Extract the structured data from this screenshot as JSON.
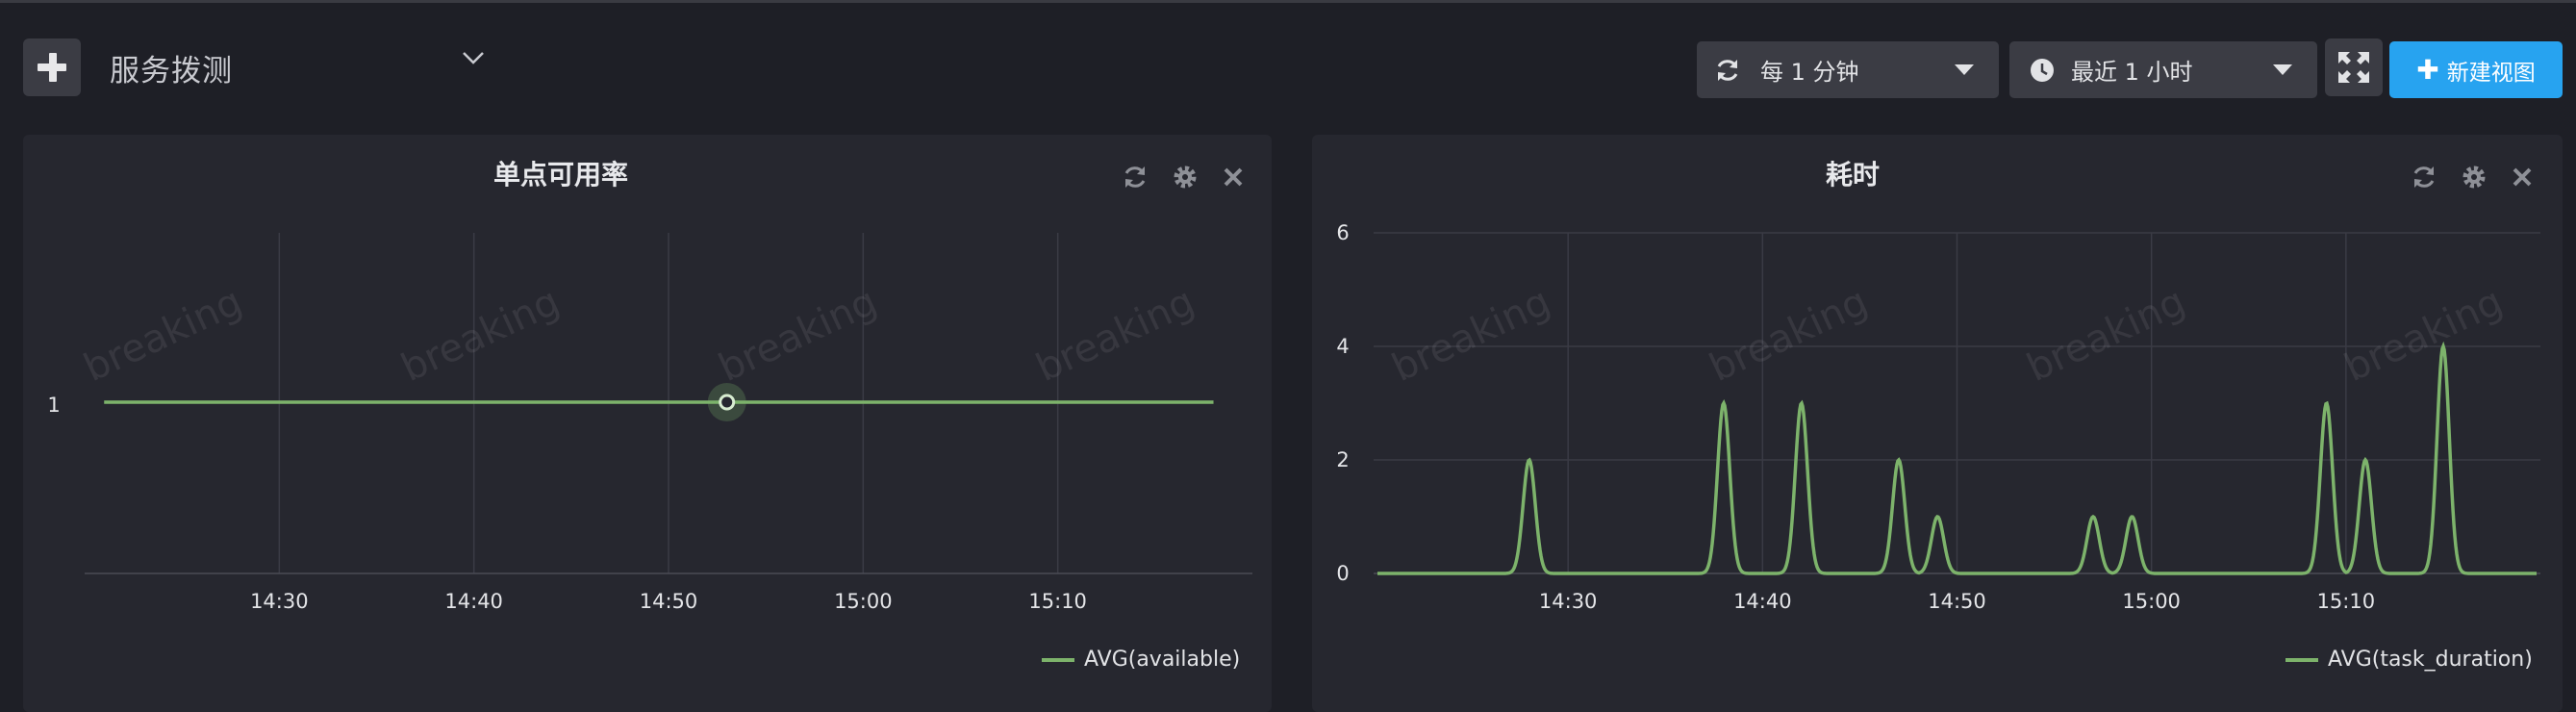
{
  "toolbar": {
    "title": "服务拨测",
    "refresh_interval": "每 1 分钟",
    "time_range": "最近 1 小时",
    "new_view_label": "新建视图"
  },
  "watermark_text": "breaking",
  "colors": {
    "line": "#7db36b",
    "accent": "#27a3f0",
    "panel": "#26272f",
    "background": "#1e1f26"
  },
  "panels": [
    {
      "title": "单点可用率",
      "icons": [
        "refresh-icon",
        "gear-icon",
        "close-icon"
      ]
    },
    {
      "title": "耗时",
      "icons": [
        "refresh-icon",
        "gear-icon",
        "close-icon"
      ]
    }
  ],
  "chart_data": [
    {
      "type": "line",
      "title": "单点可用率",
      "x_ticks": [
        "14:30",
        "14:40",
        "14:50",
        "15:00",
        "15:10"
      ],
      "y_ticks": [
        "1"
      ],
      "series": [
        {
          "name": "AVG(available)",
          "x": [
            "14:21",
            "15:18"
          ],
          "y": [
            1,
            1
          ]
        }
      ],
      "highlight_point": {
        "x": "14:53",
        "y": 1
      },
      "grid": true,
      "legend": "bottom-right"
    },
    {
      "type": "line",
      "title": "耗时",
      "x_ticks": [
        "14:30",
        "14:40",
        "14:50",
        "15:00",
        "15:10"
      ],
      "y_ticks": [
        "0",
        "2",
        "4",
        "6"
      ],
      "ylim": [
        0,
        6
      ],
      "series": [
        {
          "name": "AVG(task_duration)",
          "x": [
            "14:21",
            "14:27",
            "14:28",
            "14:29",
            "14:37",
            "14:38",
            "14:39",
            "14:41",
            "14:42",
            "14:43",
            "14:46",
            "14:47",
            "14:48",
            "14:49",
            "14:50",
            "14:51",
            "14:56",
            "14:57",
            "14:58",
            "14:59",
            "15:00",
            "15:08",
            "15:09",
            "15:10",
            "15:11",
            "15:14",
            "15:15",
            "15:16",
            "15:18"
          ],
          "y": [
            0,
            0,
            2,
            0,
            0,
            3,
            0,
            0,
            3,
            0,
            0,
            2,
            0,
            1,
            0,
            0,
            0,
            1,
            0,
            1,
            0,
            0,
            3,
            0,
            2,
            0,
            4,
            0,
            0
          ]
        }
      ],
      "grid": true,
      "legend": "bottom-right"
    }
  ]
}
